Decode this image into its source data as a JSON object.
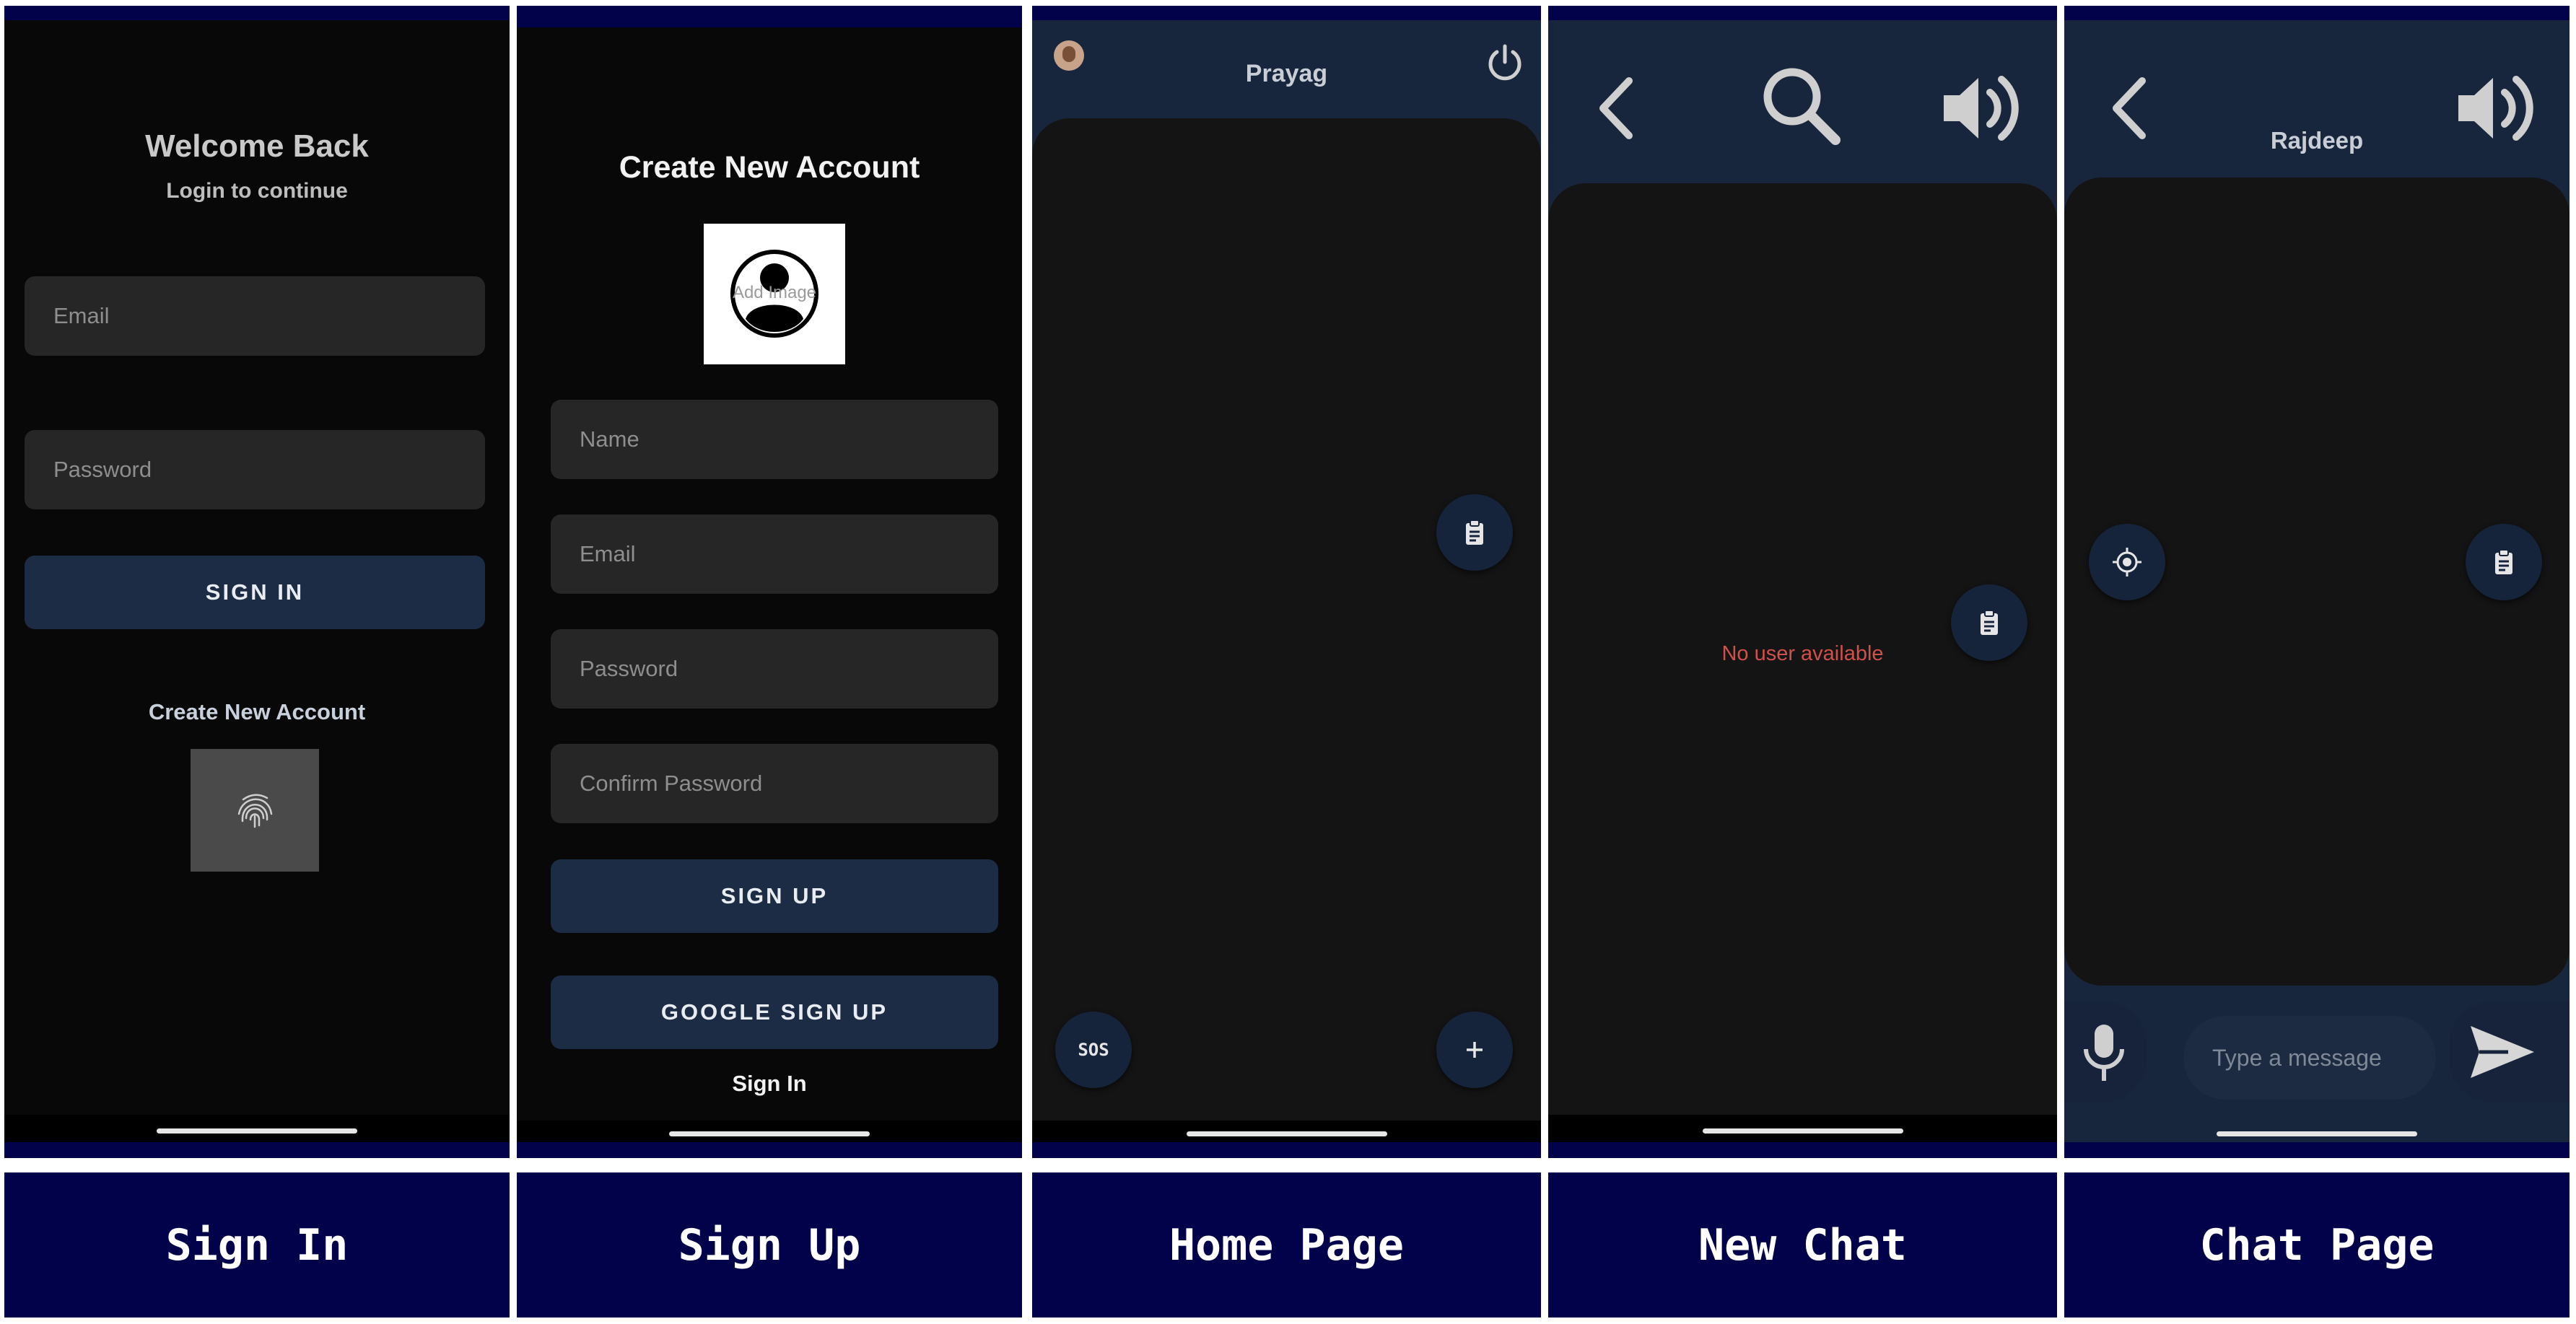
{
  "colors": {
    "caption_bg": "#02024a",
    "screen_bg": "#121212",
    "header_bg": "#18263d",
    "button_bg": "#1c2c45",
    "field_bg": "#262626",
    "empty_text": "#d0504a"
  },
  "signin": {
    "caption": "Sign In",
    "title": "Welcome Back",
    "subtitle": "Login to continue",
    "email_placeholder": "Email",
    "password_placeholder": "Password",
    "signin_button": "SIGN IN",
    "create_account_link": "Create New Account",
    "fingerprint_icon": "fingerprint-icon"
  },
  "signup": {
    "caption": "Sign Up",
    "title": "Create New Account",
    "avatar_overlay_text": "Add Image",
    "name_placeholder": "Name",
    "email_placeholder": "Email",
    "password_placeholder": "Password",
    "confirm_password_placeholder": "Confirm Password",
    "signup_button": "SIGN UP",
    "google_signup_button": "GOOGLE SIGN UP",
    "signin_link": "Sign In"
  },
  "home": {
    "caption": "Home Page",
    "username": "Prayag",
    "sos_label": "SOS",
    "power_icon": "power-icon",
    "clipboard_icon": "clipboard-icon",
    "add_icon": "plus-icon"
  },
  "newchat": {
    "caption": "New Chat",
    "empty_message": "No user available",
    "back_icon": "back-icon",
    "search_icon": "search-icon",
    "speaker_icon": "speaker-icon"
  },
  "chat": {
    "caption": "Chat Page",
    "contact_name": "Rajdeep",
    "message_placeholder": "Type a message",
    "back_icon": "back-icon",
    "speaker_icon": "speaker-icon",
    "location_icon": "location-icon",
    "mic_icon": "mic-icon",
    "send_icon": "send-icon"
  }
}
